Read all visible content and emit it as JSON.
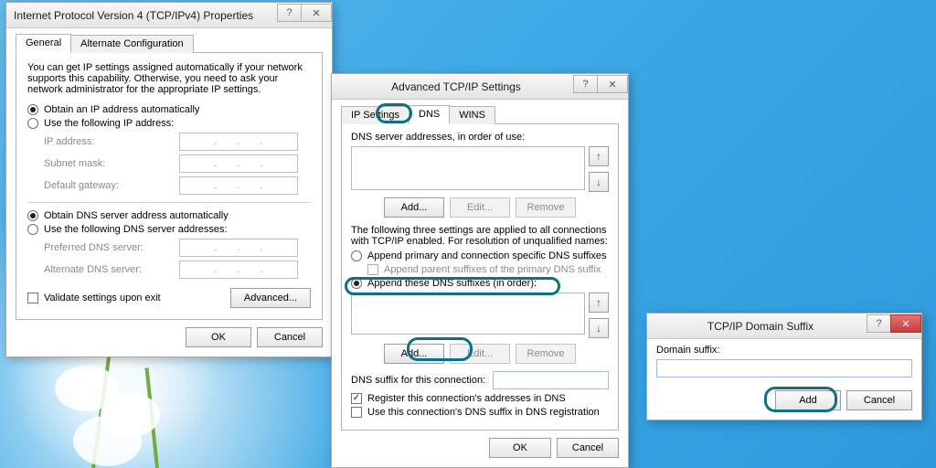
{
  "d1": {
    "title": "Internet Protocol Version 4 (TCP/IPv4) Properties",
    "tabs": {
      "general": "General",
      "alt": "Alternate Configuration"
    },
    "intro": "You can get IP settings assigned automatically if your network supports this capability. Otherwise, you need to ask your network administrator for the appropriate IP settings.",
    "ip_auto": "Obtain an IP address automatically",
    "ip_manual": "Use the following IP address:",
    "ip_address": "IP address:",
    "subnet": "Subnet mask:",
    "gateway": "Default gateway:",
    "dns_auto": "Obtain DNS server address automatically",
    "dns_manual": "Use the following DNS server addresses:",
    "pref_dns": "Preferred DNS server:",
    "alt_dns": "Alternate DNS server:",
    "validate": "Validate settings upon exit",
    "advanced": "Advanced...",
    "ok": "OK",
    "cancel": "Cancel"
  },
  "d2": {
    "title": "Advanced TCP/IP Settings",
    "tabs": {
      "ip": "IP Settings",
      "dns": "DNS",
      "wins": "WINS"
    },
    "dns_list_label": "DNS server addresses, in order of use:",
    "add": "Add...",
    "edit": "Edit...",
    "remove": "Remove",
    "note": "The following three settings are applied to all connections with TCP/IP enabled. For resolution of unqualified names:",
    "opt_primary": "Append primary and connection specific DNS suffixes",
    "opt_parent": "Append parent suffixes of the primary DNS suffix",
    "opt_these": "Append these DNS suffixes (in order):",
    "dns_suffix_conn": "DNS suffix for this connection:",
    "register": "Register this connection's addresses in DNS",
    "use_suffix": "Use this connection's DNS suffix in DNS registration",
    "ok": "OK",
    "cancel": "Cancel"
  },
  "d3": {
    "title": "TCP/IP Domain Suffix",
    "label": "Domain suffix:",
    "value": "",
    "add": "Add",
    "cancel": "Cancel"
  }
}
